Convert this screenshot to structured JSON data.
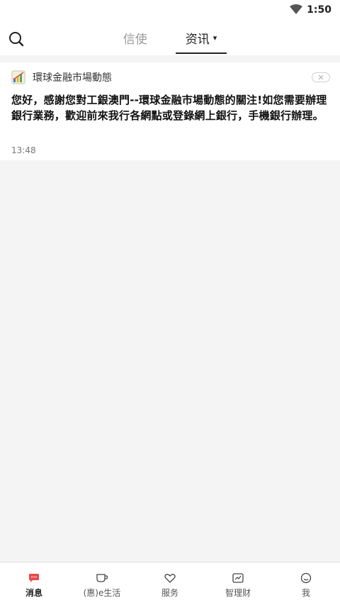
{
  "status": {
    "time": "1:50"
  },
  "header": {
    "tabs": [
      {
        "label": "信使",
        "active": false
      },
      {
        "label": "资讯",
        "active": true
      }
    ],
    "active_caret": "▾"
  },
  "message_card": {
    "sender": "環球金融市場動態",
    "body": "您好，感謝您對工銀澳門--環球金融市場動態的關注!如您需要辦理銀行業務，歡迎前來我行各網點或登錄網上銀行，手機銀行辦理。",
    "time": "13:48"
  },
  "bottom_nav": {
    "items": [
      {
        "label": "消息",
        "icon": "chat-bubble-icon",
        "active": true
      },
      {
        "label": "(惠)e生活",
        "icon": "coffee-cup-icon",
        "active": false
      },
      {
        "label": "服务",
        "icon": "heart-icon",
        "active": false
      },
      {
        "label": "智理财",
        "icon": "chart-icon",
        "active": false
      },
      {
        "label": "我",
        "icon": "smile-icon",
        "active": false
      }
    ]
  },
  "colors": {
    "accent": "#e84a4a",
    "text": "#222222",
    "muted": "#9a9a9a"
  }
}
